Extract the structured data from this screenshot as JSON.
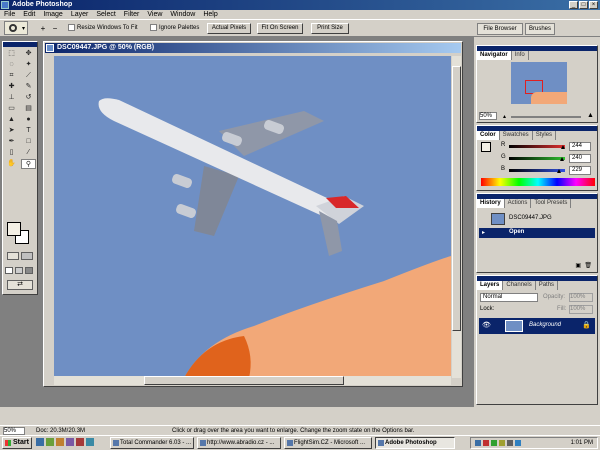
{
  "app": {
    "title": "Adobe Photoshop",
    "window_buttons": [
      "_",
      "□",
      "×"
    ]
  },
  "menu": [
    "File",
    "Edit",
    "Image",
    "Layer",
    "Select",
    "Filter",
    "View",
    "Window",
    "Help"
  ],
  "options": {
    "zoom_in": "+",
    "zoom_out": "−",
    "resize_windows": "Resize Windows To Fit",
    "ignore_palettes": "Ignore Palettes",
    "actual_pixels": "Actual Pixels",
    "fit_on_screen": "Fit On Screen",
    "print_size": "Print Size",
    "palette_well": [
      "File Browser",
      "Brushes"
    ]
  },
  "document": {
    "title": "DSC09447.JPG @ 50% (RGB)"
  },
  "navigator": {
    "tabs": [
      "Navigator",
      "Info"
    ],
    "zoom": "50%"
  },
  "color": {
    "tabs": [
      "Color",
      "Swatches",
      "Styles"
    ],
    "channels": [
      {
        "label": "R",
        "value": "244",
        "color": "#e03030"
      },
      {
        "label": "G",
        "value": "240",
        "color": "#30c030"
      },
      {
        "label": "B",
        "value": "229",
        "color": "#3050e0"
      }
    ],
    "r_pos": 0.96,
    "g_pos": 0.94,
    "b_pos": 0.9
  },
  "history": {
    "tabs": [
      "History",
      "Actions",
      "Tool Presets"
    ],
    "snapshot": "DSC09447.JPG",
    "state": "Open"
  },
  "layers": {
    "tabs": [
      "Layers",
      "Channels",
      "Paths"
    ],
    "blend_mode": "Normal",
    "opacity_label": "Opacity:",
    "opacity_value": "100%",
    "lock_label": "Lock:",
    "fill_label": "Fill:",
    "fill_value": "100%",
    "layer_name": "Background"
  },
  "status": {
    "zoom": "50%",
    "doc": "Doc: 20.3M/20.3M",
    "hint": "Click or drag over the area you want to enlarge. Change the zoom state on the Options bar."
  },
  "taskbar": {
    "start": "Start",
    "tasks": [
      "Total Commander 6.03 - ...",
      "http://www.abradio.cz - ...",
      "FlightSim.CZ - Microsoft ...",
      "Adobe Photoshop"
    ],
    "time": "1:01 PM"
  },
  "accent": "#0a246a",
  "sky_color": "#6f8fc4"
}
